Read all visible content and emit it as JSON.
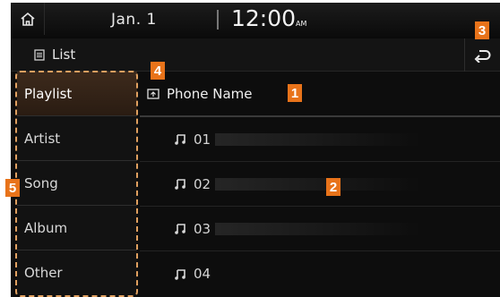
{
  "statusbar": {
    "date": "Jan.  1",
    "time": "12:00",
    "ampm": "AM"
  },
  "titlebar": {
    "title": "List"
  },
  "sidebar": {
    "items": [
      {
        "label": "Playlist",
        "active": true
      },
      {
        "label": "Artist"
      },
      {
        "label": "Song"
      },
      {
        "label": "Album"
      },
      {
        "label": "Other"
      }
    ]
  },
  "content": {
    "header": "Phone Name",
    "rows": [
      "01",
      "02",
      "03",
      "04"
    ]
  },
  "callouts": [
    "1",
    "2",
    "3",
    "4",
    "5"
  ],
  "colors": {
    "accent": "#e8731a",
    "active": "#3d2a1c",
    "background": "#0d0d0d"
  },
  "icons": [
    "home-icon",
    "list-icon",
    "back-icon",
    "folder-icon",
    "music-note-icon"
  ]
}
